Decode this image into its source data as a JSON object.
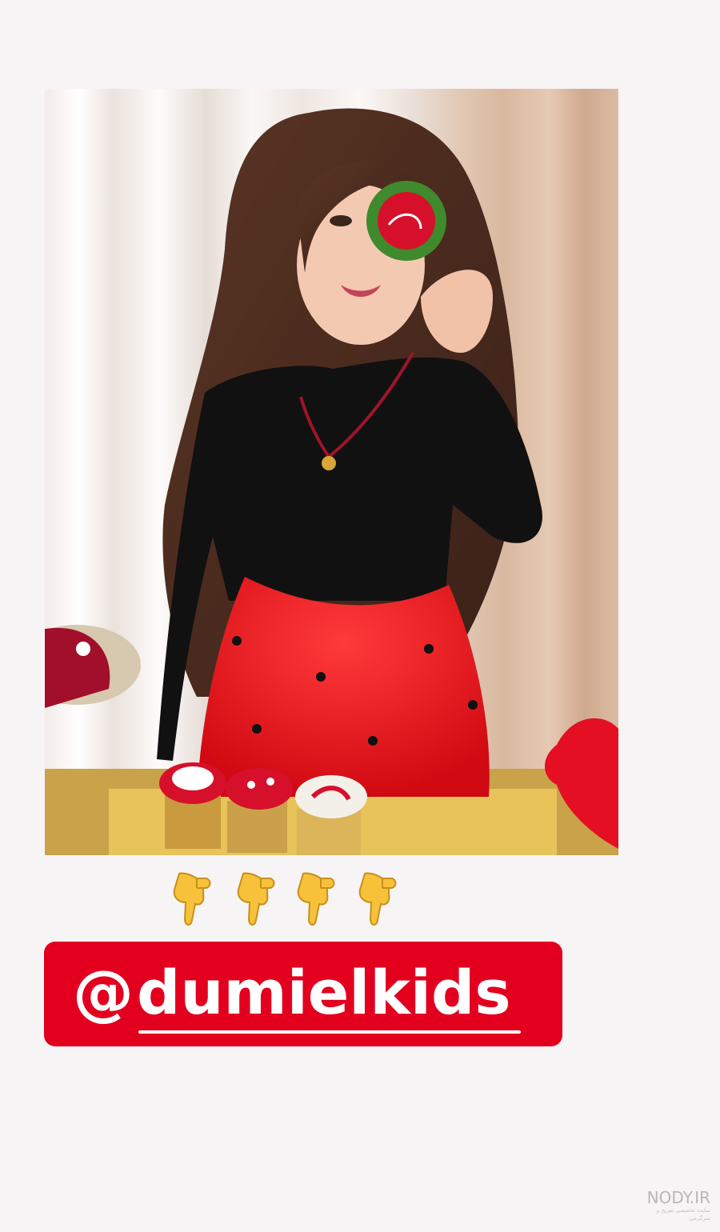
{
  "story": {
    "photo_description_icon": "girl-holding-cookie-photo",
    "pointer_emoji": "backhand-pointing-down",
    "pointer_count": 4,
    "mention_handle": "@dumielkids",
    "mention_at": "@",
    "mention_name": "dumielkids",
    "mention_bg_color": "#e3001f"
  },
  "watermark": {
    "title": "NODY.IR",
    "subtitle": "سایت تخصصی تفریح و سرگرمی"
  }
}
